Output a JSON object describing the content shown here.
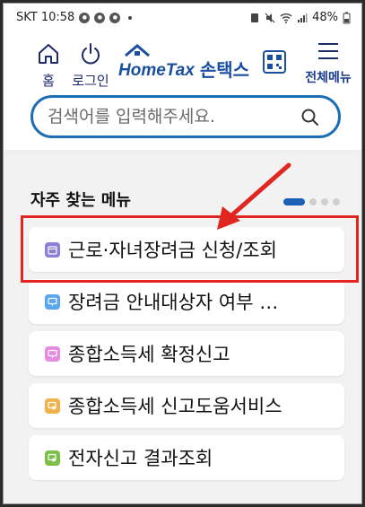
{
  "status_bar": {
    "time": "SKT 10:58",
    "battery": "48%"
  },
  "header": {
    "home_label": "홈",
    "login_label": "로그인",
    "logo_text": "HomeTax",
    "logo_korean": "손택스",
    "menu_label": "전체메뉴"
  },
  "search": {
    "placeholder": "검색어를 입력해주세요."
  },
  "favorites": {
    "title": "자주 찾는 메뉴",
    "pager_pages": 4,
    "pager_active": 1,
    "items": [
      {
        "label": "근로·자녀장려금 신청/조회",
        "icon_color": "#8b7fd6",
        "icon": "calendar-icon"
      },
      {
        "label": "장려금 안내대상자 여부 …",
        "icon_color": "#5aa7f0",
        "icon": "monitor-icon"
      },
      {
        "label": "종합소득세 확정신고",
        "icon_color": "#e58be0",
        "icon": "monitor-icon"
      },
      {
        "label": "종합소득세 신고도움서비스",
        "icon_color": "#f0b24a",
        "icon": "chat-search-icon"
      },
      {
        "label": "전자신고 결과조회",
        "icon_color": "#7cc04a",
        "icon": "chat-search-icon"
      }
    ]
  },
  "colors": {
    "brand_blue": "#1a4fa0",
    "search_border": "#1d6db4",
    "highlight": "#e0261f"
  }
}
